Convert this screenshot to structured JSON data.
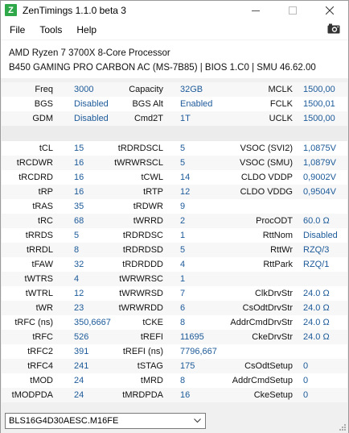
{
  "window": {
    "title": "ZenTimings 1.1.0 beta 3",
    "app_icon_letter": "Z"
  },
  "menu": {
    "items": [
      "File",
      "Tools",
      "Help"
    ]
  },
  "sysinfo": {
    "cpu": "AMD Ryzen 7 3700X 8-Core Processor",
    "board": "B450 GAMING PRO CARBON AC (MS-7B85) | BIOS 1.C0 | SMU 46.62.00"
  },
  "top_rows": [
    [
      [
        "Freq",
        "3000"
      ],
      [
        "Capacity",
        "32GB"
      ],
      [
        "MCLK",
        "1500,00"
      ]
    ],
    [
      [
        "BGS",
        "Disabled"
      ],
      [
        "BGS Alt",
        "Enabled"
      ],
      [
        "FCLK",
        "1500,01"
      ]
    ],
    [
      [
        "GDM",
        "Disabled"
      ],
      [
        "Cmd2T",
        "1T"
      ],
      [
        "UCLK",
        "1500,00"
      ]
    ]
  ],
  "timing_rows": [
    [
      [
        "tCL",
        "15"
      ],
      [
        "tRDRDSCL",
        "5"
      ],
      [
        "VSOC (SVI2)",
        "1,0875V"
      ]
    ],
    [
      [
        "tRCDWR",
        "16"
      ],
      [
        "tWRWRSCL",
        "5"
      ],
      [
        "VSOC (SMU)",
        "1,0879V"
      ]
    ],
    [
      [
        "tRCDRD",
        "16"
      ],
      [
        "tCWL",
        "14"
      ],
      [
        "CLDO VDDP",
        "0,9002V"
      ]
    ],
    [
      [
        "tRP",
        "16"
      ],
      [
        "tRTP",
        "12"
      ],
      [
        "CLDO VDDG",
        "0,9504V"
      ]
    ],
    [
      [
        "tRAS",
        "35"
      ],
      [
        "tRDWR",
        "9"
      ],
      [
        "",
        ""
      ]
    ],
    [
      [
        "tRC",
        "68"
      ],
      [
        "tWRRD",
        "2"
      ],
      [
        "ProcODT",
        "60.0 Ω"
      ]
    ],
    [
      [
        "tRRDS",
        "5"
      ],
      [
        "tRDRDSC",
        "1"
      ],
      [
        "RttNom",
        "Disabled"
      ]
    ],
    [
      [
        "tRRDL",
        "8"
      ],
      [
        "tRDRDSD",
        "5"
      ],
      [
        "RttWr",
        "RZQ/3"
      ]
    ],
    [
      [
        "tFAW",
        "32"
      ],
      [
        "tRDRDDD",
        "4"
      ],
      [
        "RttPark",
        "RZQ/1"
      ]
    ],
    [
      [
        "tWTRS",
        "4"
      ],
      [
        "tWRWRSC",
        "1"
      ],
      [
        "",
        ""
      ]
    ],
    [
      [
        "tWTRL",
        "12"
      ],
      [
        "tWRWRSD",
        "7"
      ],
      [
        "ClkDrvStr",
        "24.0 Ω"
      ]
    ],
    [
      [
        "tWR",
        "23"
      ],
      [
        "tWRWRDD",
        "6"
      ],
      [
        "CsOdtDrvStr",
        "24.0 Ω"
      ]
    ],
    [
      [
        "tRFC (ns)",
        "350,6667"
      ],
      [
        "tCKE",
        "8"
      ],
      [
        "AddrCmdDrvStr",
        "24.0 Ω"
      ]
    ],
    [
      [
        "tRFC",
        "526"
      ],
      [
        "tREFI",
        "11695"
      ],
      [
        "CkeDrvStr",
        "24.0 Ω"
      ]
    ],
    [
      [
        "tRFC2",
        "391"
      ],
      [
        "tREFI (ns)",
        "7796,667"
      ],
      [
        "",
        ""
      ]
    ],
    [
      [
        "tRFC4",
        "241"
      ],
      [
        "tSTAG",
        "175"
      ],
      [
        "CsOdtSetup",
        "0"
      ]
    ],
    [
      [
        "tMOD",
        "24"
      ],
      [
        "tMRD",
        "8"
      ],
      [
        "AddrCmdSetup",
        "0"
      ]
    ],
    [
      [
        "tMODPDA",
        "24"
      ],
      [
        "tMRDPDA",
        "16"
      ],
      [
        "CkeSetup",
        "0"
      ]
    ]
  ],
  "module_select": {
    "selected": "BLS16G4D30AESC.M16FE"
  },
  "icons": {
    "minimize": "minimize-icon",
    "maximize": "maximize-icon",
    "close": "close-icon",
    "screenshot": "camera-icon",
    "dropdown": "chevron-down-icon"
  },
  "colors": {
    "value": "#1c5a99",
    "app_icon": "#2fa84a"
  }
}
